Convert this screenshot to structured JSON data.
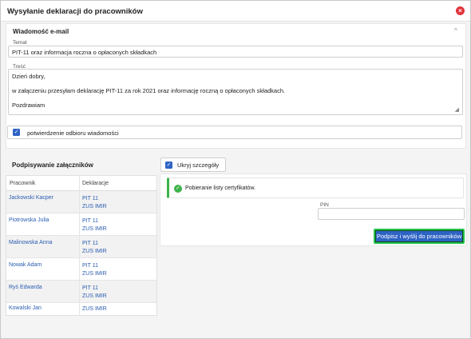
{
  "dialog": {
    "title": "Wysyłanie deklaracji do pracowników",
    "close_icon": "×"
  },
  "email": {
    "section_label": "Wiadomość e-mail",
    "chevron": "^",
    "subject_label": "Temat",
    "subject_value": "PIT-11 oraz informacja roczna o opłaconych składkach",
    "body_label": "Treść",
    "body_lines": [
      "Dzień dobry,",
      "w załączeniu przesyłam deklarację PIT-11 za rok 2021 oraz informację roczną o opłaconych składkach.",
      "Pozdrawiam"
    ],
    "confirm_label": "potwierdzenie odbioru wiadomości"
  },
  "signing": {
    "section_label": "Podpisywanie załączników",
    "hide_details_label": "Ukryj szczegóły",
    "columns": [
      "Pracownik",
      "Deklaracje"
    ],
    "rows": [
      {
        "name": "Jackowski Kacper",
        "docs": [
          "PIT 11",
          "ZUS IMIR"
        ]
      },
      {
        "name": "Piotrowska Julia",
        "docs": [
          "PIT 11",
          "ZUS IMIR"
        ]
      },
      {
        "name": "Malinowska Anna",
        "docs": [
          "PIT 11",
          "ZUS IMIR"
        ]
      },
      {
        "name": "Nowak Adam",
        "docs": [
          "PIT 11",
          "ZUS IMIR"
        ]
      },
      {
        "name": "Ryś Edwarda",
        "docs": [
          "PIT 11",
          "ZUS IMIR"
        ]
      },
      {
        "name": "Kowalski Jan",
        "docs": [
          "ZUS IMIR"
        ]
      }
    ],
    "alert_text": "Pobieranie listy certyfikatów.",
    "pin_label": "PIN",
    "pin_value": "",
    "submit_label": "Podpisz i wyślij do pracowników"
  },
  "colors": {
    "accent": "#2e63c4",
    "success": "#3cb34a",
    "danger": "#e0353b",
    "link": "#2a5db0"
  }
}
